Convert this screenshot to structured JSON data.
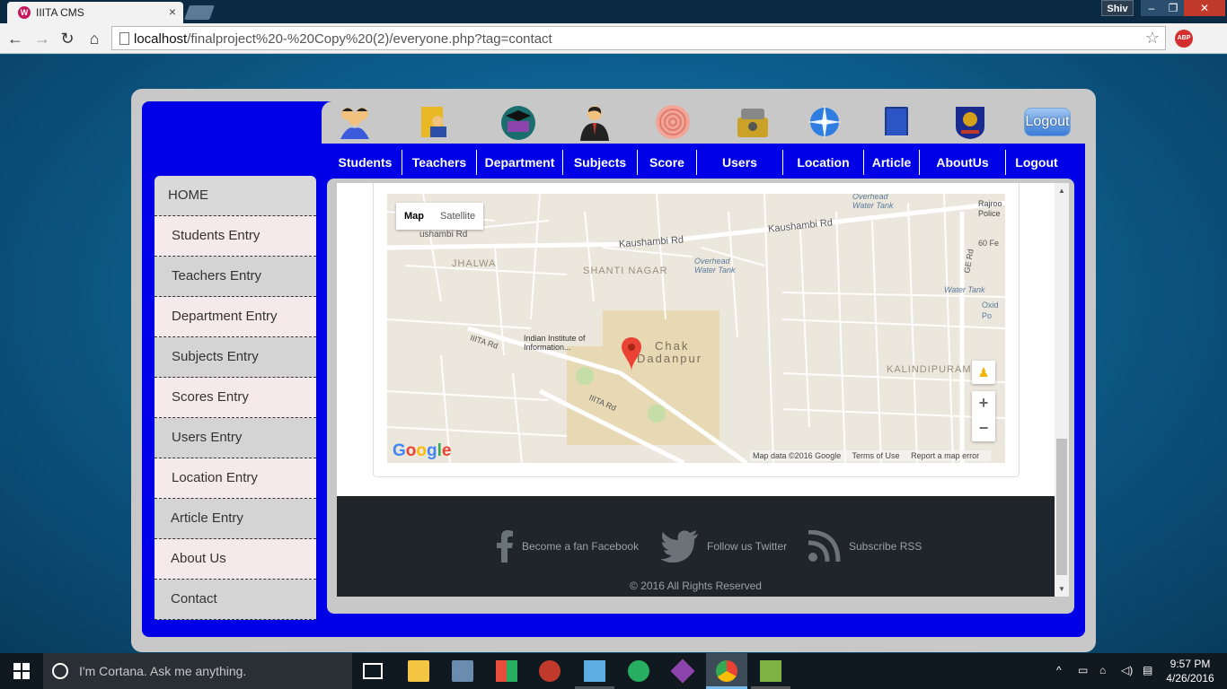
{
  "browser": {
    "tab_title": "IIITA CMS",
    "tab_favicon": "W",
    "tab_close": "×",
    "profile_name": "Shiv",
    "window_controls": {
      "minimize": "–",
      "maximize": "❐",
      "close": "✕"
    },
    "url_host": "localhost",
    "url_path": "/finalproject%20-%20Copy%20(2)/everyone.php?tag=contact",
    "abp_label": "ABP",
    "nav_icons": {
      "back": "←",
      "forward": "→",
      "reload": "↻",
      "home": "⌂",
      "star": "☆",
      "menu": "≡"
    }
  },
  "header": {
    "logout_button": "Logout",
    "icons": [
      "students-icon",
      "teachers-icon",
      "department-icon",
      "subjects-icon",
      "score-icon",
      "users-icon",
      "location-icon",
      "article-icon",
      "aboutus-icon"
    ]
  },
  "nav": {
    "items": [
      "Students",
      "Teachers",
      "Department",
      "Subjects",
      "Score",
      "Users",
      "Location",
      "Article",
      "AboutUs",
      "Logout"
    ]
  },
  "sidebar": {
    "items": [
      "HOME",
      "Students Entry",
      "Teachers Entry",
      "Department Entry",
      "Subjects Entry",
      "Scores Entry",
      "Users Entry",
      "Location Entry",
      "Article Entry",
      "About Us",
      "Contact"
    ]
  },
  "map": {
    "type_map": "Map",
    "type_satellite": "Satellite",
    "labels": {
      "road1": "Kaushambi Rd",
      "road1b": "Kaushambi Rd",
      "road2": "ushambi Rd",
      "area1": "JHALWA",
      "area2": "SHANTI NAGAR",
      "water1": "Overhead Water Tank",
      "water2": "Overhead Water Tank",
      "water3": "Water Tank",
      "police": "Rajroo Police",
      "road3": "60 Fe",
      "road4": "GE Rd",
      "oxid": "Oxid Po",
      "inst": "Indian Institute of Information...",
      "road5": "IIITA Rd",
      "road6": "IIITA Rd",
      "chak1": "Chak",
      "chak2": "Dadanpur",
      "area3": "KALINDIPURAM"
    },
    "attribution": {
      "data": "Map data ©2016 Google",
      "terms": "Terms of Use",
      "report": "Report a map error"
    },
    "zoom_in": "+",
    "zoom_out": "−",
    "google": [
      "G",
      "o",
      "o",
      "g",
      "l",
      "e"
    ]
  },
  "footer": {
    "facebook": "Become a fan Facebook",
    "twitter": "Follow us Twitter",
    "rss": "Subscribe RSS",
    "copyright": "© 2016 All Rights Reserved"
  },
  "taskbar": {
    "search_placeholder": "I'm Cortana. Ask me anything.",
    "time": "9:57 PM",
    "date": "4/26/2016"
  },
  "colors": {
    "accent_blue": "#0000e6",
    "frame_gray": "#c8c8c8",
    "footer_bg": "#1f2528"
  }
}
